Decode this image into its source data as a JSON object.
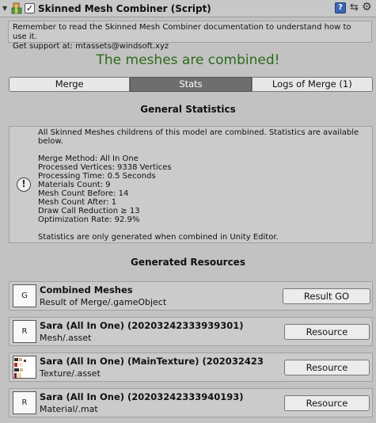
{
  "component": {
    "title": "Skinned Mesh Combiner (Script)",
    "enabled_mark": "✓",
    "help_icon": "question-mark-icon",
    "help_glyph": "?",
    "preset_glyph": "⇆",
    "gear_glyph": "⚙"
  },
  "note": {
    "line1": "Remember to read the Skinned Mesh Combiner documentation to understand how to use it.",
    "line2": "Get support at: mtassets@windsoft.xyz"
  },
  "status": {
    "text": "The meshes are combined!",
    "color": "#2c6b1c"
  },
  "tabs": [
    {
      "label": "Merge",
      "active": false
    },
    {
      "label": "Stats",
      "active": true
    },
    {
      "label": "Logs of Merge (1)",
      "active": false
    }
  ],
  "general": {
    "title": "General Statistics",
    "info_glyph": "!",
    "intro": "All Skinned Meshes childrens of this model are combined. Statistics are available below.",
    "lines": [
      "Merge Method: All In One",
      "Processed Vertices: 9338 Vertices",
      "Processing Time: 0.5 Seconds",
      "Materials Count: 9",
      "Mesh Count Before: 14",
      "Mesh Count After: 1",
      "Draw Call Reduction ≥ 13",
      "Optimization Rate: 92.9%"
    ],
    "footer": "Statistics are only generated when combined in Unity Editor."
  },
  "resources": {
    "title": "Generated Resources",
    "items": [
      {
        "icon_letter": "G",
        "name": "Combined Meshes",
        "path": "Result of Merge/.gameObject",
        "button": "Result GO"
      },
      {
        "icon_letter": "R",
        "name": "Sara (All In One) (20203242333939301)",
        "path": "Mesh/.asset",
        "button": "Resource"
      },
      {
        "icon_letter": "",
        "name": "Sara (All In One) (MainTexture) (202032423",
        "path": "Texture/.asset",
        "button": "Resource"
      },
      {
        "icon_letter": "R",
        "name": "Sara (All In One) (20203242333940193)",
        "path": "Material/.mat",
        "button": "Resource"
      }
    ]
  }
}
